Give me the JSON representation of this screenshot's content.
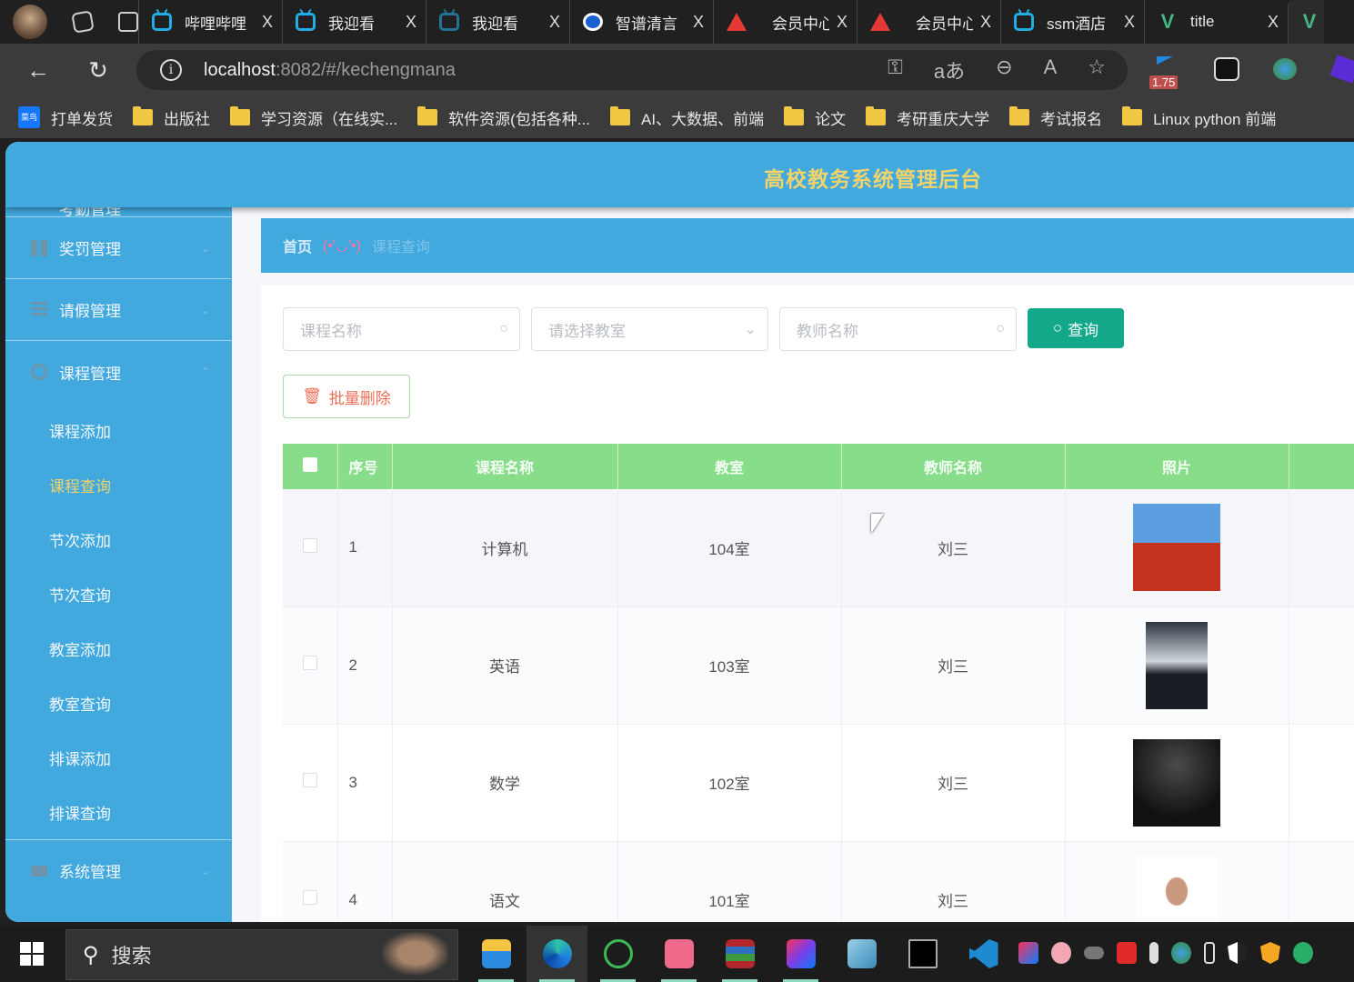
{
  "browser": {
    "tabs": [
      {
        "title": "哔哩哔哩",
        "icon": "bilibili-icon"
      },
      {
        "title": "我迎看",
        "icon": "bilibili-icon"
      },
      {
        "title": "我迎看",
        "icon": "bilibili-icon"
      },
      {
        "title": "智谱清言",
        "icon": "zhipu-icon"
      },
      {
        "title": "会员中心",
        "icon": "triangle-logo-icon"
      },
      {
        "title": "会员中心",
        "icon": "triangle-logo-icon"
      },
      {
        "title": "ssm酒店",
        "icon": "bilibili-icon"
      },
      {
        "title": "title",
        "icon": "vue-icon"
      }
    ],
    "close_glyph": "X",
    "url_host": "localhost",
    "url_rest": ":8082/#/kechengmana",
    "speed_badge": "1.75",
    "bookmarks": [
      {
        "label": "打单发货",
        "icon": "cainiao-icon"
      },
      {
        "label": "出版社",
        "icon": "folder-icon"
      },
      {
        "label": "学习资源（在线实...",
        "icon": "folder-icon"
      },
      {
        "label": "软件资源(包括各种...",
        "icon": "folder-icon"
      },
      {
        "label": "AI、大数据、前端",
        "icon": "folder-icon"
      },
      {
        "label": "论文",
        "icon": "folder-icon"
      },
      {
        "label": "考研重庆大学",
        "icon": "folder-icon"
      },
      {
        "label": "考试报名",
        "icon": "folder-icon"
      },
      {
        "label": "Linux python 前端",
        "icon": "folder-icon"
      }
    ]
  },
  "app": {
    "title": "高校教务系统管理后台",
    "sidebar": {
      "menus": [
        {
          "label": "考勤管理",
          "partial": true
        },
        {
          "label": "奖罚管理"
        },
        {
          "label": "请假管理"
        },
        {
          "label": "课程管理",
          "expanded": true
        }
      ],
      "submenu": [
        {
          "label": "课程添加"
        },
        {
          "label": "课程查询",
          "active": true
        },
        {
          "label": "节次添加"
        },
        {
          "label": "节次查询"
        },
        {
          "label": "教室添加"
        },
        {
          "label": "教室查询"
        },
        {
          "label": "排课添加"
        },
        {
          "label": "排课查询"
        }
      ],
      "bottom_menu": {
        "label": "系统管理"
      }
    },
    "breadcrumb": {
      "home": "首页",
      "kaomoji": "(•'◡'•)",
      "current": "课程查询"
    },
    "filters": {
      "course_name_placeholder": "课程名称",
      "classroom_placeholder": "请选择教室",
      "teacher_placeholder": "教师名称",
      "query_label": "查询"
    },
    "batch_delete_label": "批量删除",
    "table": {
      "headers": [
        "序号",
        "课程名称",
        "教室",
        "教师名称",
        "照片"
      ],
      "rows": [
        {
          "idx": "1",
          "course": "计算机",
          "room": "104室",
          "teacher": "刘三",
          "photo": "red-shirt-portrait"
        },
        {
          "idx": "2",
          "course": "英语",
          "room": "103室",
          "teacher": "刘三",
          "photo": "suit-portrait"
        },
        {
          "idx": "3",
          "course": "数学",
          "room": "102室",
          "teacher": "刘三",
          "photo": "dark-suit-portrait"
        },
        {
          "idx": "4",
          "course": "语文",
          "room": "101室",
          "teacher": "刘三",
          "photo": "white-bg-portrait"
        }
      ]
    }
  },
  "taskbar": {
    "search_label": "搜索"
  }
}
